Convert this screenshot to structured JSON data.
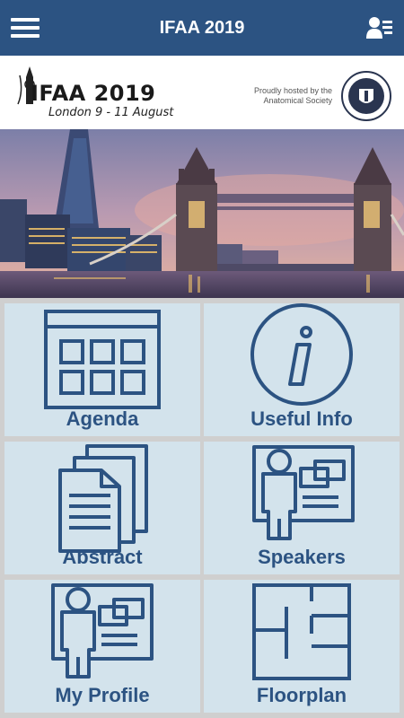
{
  "header": {
    "title": "IFAA 2019"
  },
  "banner": {
    "logo_title": "IFAA 2019",
    "logo_subtitle": "London 9 - 11 August",
    "hosted_by": "Proudly hosted by the Anatomical Society"
  },
  "tiles": [
    {
      "label": "Agenda",
      "icon": "calendar-icon"
    },
    {
      "label": "Useful Info",
      "icon": "info-icon"
    },
    {
      "label": "Abstract",
      "icon": "documents-icon"
    },
    {
      "label": "Speakers",
      "icon": "presenter-icon"
    },
    {
      "label": "My Profile",
      "icon": "profile-icon"
    },
    {
      "label": "Floorplan",
      "icon": "floorplan-icon"
    }
  ],
  "colors": {
    "header": "#2c5382",
    "tile_bg": "#d3e3ec",
    "accent": "#2c5382"
  }
}
